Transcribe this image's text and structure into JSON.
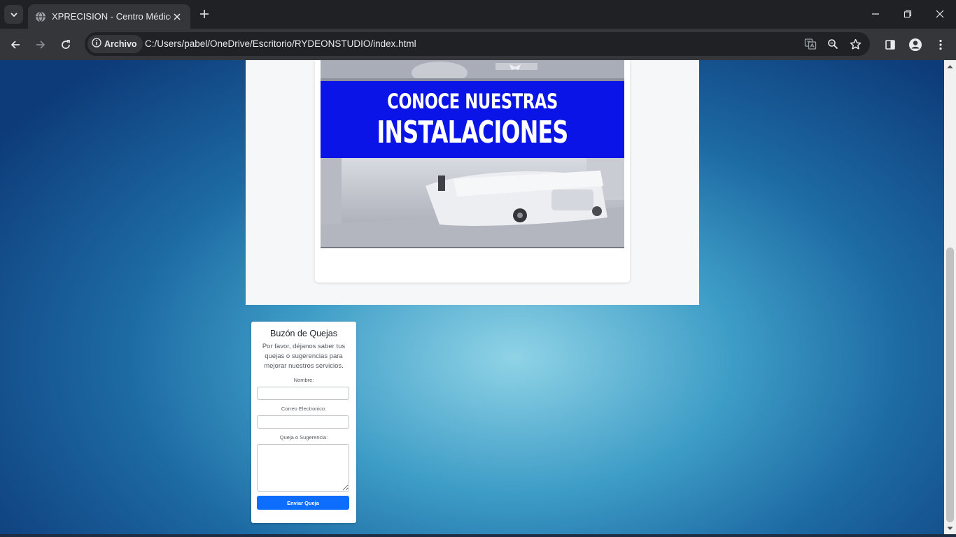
{
  "browser": {
    "tab": {
      "title": "XPRECISION - Centro Médico"
    },
    "address_bar": {
      "security_label": "Archivo",
      "url": "C:/Users/pabel/OneDrive/Escritorio/RYDEONSTUDIO/index.html"
    },
    "icons": [
      "tab-search-icon",
      "globe-icon",
      "close-icon",
      "plus-icon",
      "minimize-icon",
      "restore-icon",
      "close-window-icon",
      "back-icon",
      "forward-icon",
      "reload-icon",
      "info-icon",
      "translate-icon",
      "zoom-icon",
      "star-icon",
      "side-panel-icon",
      "profile-icon",
      "menu-icon"
    ]
  },
  "page": {
    "promo": {
      "line1": "CONOCE NUESTRAS",
      "line2": "INSTALACIONES",
      "banner_color": "#0a14e6"
    },
    "complaint_form": {
      "title": "Buzón de Quejas",
      "description": "Por favor, déjanos saber tus quejas o sugerencias para mejorar nuestros servicios.",
      "fields": {
        "name_label": "Nombre:",
        "email_label": "Correo Electronico:",
        "message_label": "Queja o Sugerencia:"
      },
      "submit_label": "Enviar Queja",
      "accent_color": "#0d6efd"
    }
  }
}
